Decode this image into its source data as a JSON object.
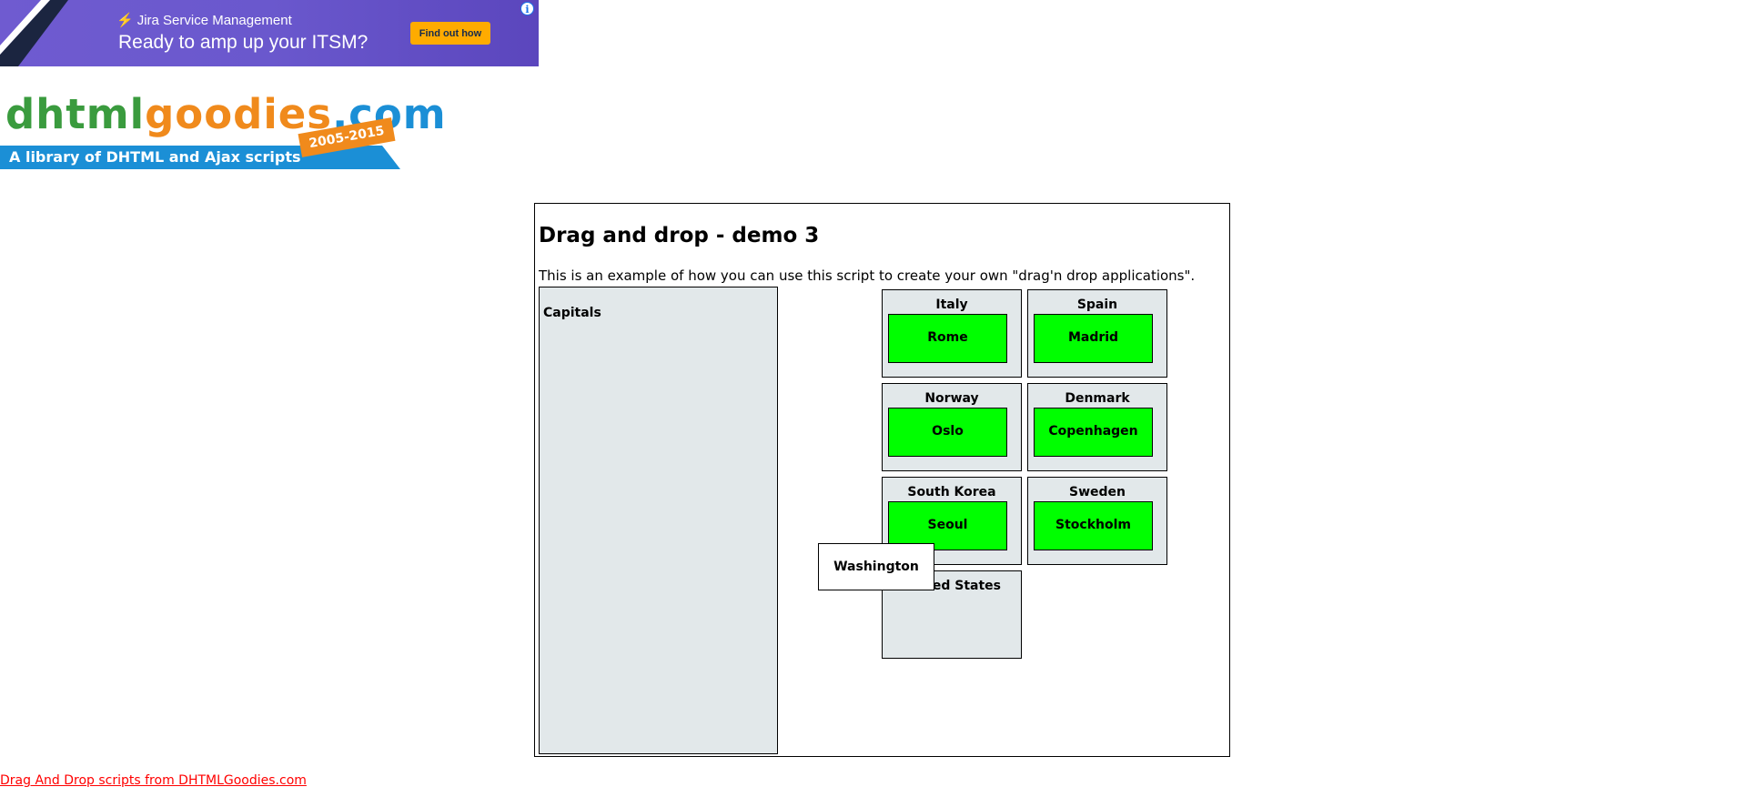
{
  "ad": {
    "brand": "Jira Service Management",
    "headline": "Ready to amp up your ITSM?",
    "cta_label": "Find out how",
    "info_icon": "info-icon",
    "colors": {
      "background": "#6a58cd",
      "cta": "#ffab00"
    }
  },
  "logo": {
    "part_a": "dhtml",
    "part_b": "goodies",
    "part_c": ".com",
    "years": "2005-2015",
    "tagline": "A library of DHTML and Ajax scripts",
    "colors": {
      "green": "#3a9b3e",
      "orange": "#f08a1c",
      "blue": "#1b8fd6"
    }
  },
  "demo": {
    "title": "Drag and drop - demo 3",
    "description": "This is an example of how you can use this script to create your own \"drag'n drop applications\".",
    "capitals_title": "Capitals",
    "countries": [
      {
        "name": "Italy",
        "capital": "Rome"
      },
      {
        "name": "Spain",
        "capital": "Madrid"
      },
      {
        "name": "Norway",
        "capital": "Oslo"
      },
      {
        "name": "Denmark",
        "capital": "Copenhagen"
      },
      {
        "name": "South Korea",
        "capital": "Seoul"
      },
      {
        "name": "Sweden",
        "capital": "Stockholm"
      },
      {
        "name": "United States",
        "capital": ""
      }
    ],
    "dragging_capital": "Washington",
    "colors": {
      "drop_zone": "#e2e8ea",
      "placed_capital": "#00ff00"
    }
  },
  "footer": {
    "link_text": "Drag And Drop scripts from DHTMLGoodies.com",
    "color": "#ff0000"
  }
}
